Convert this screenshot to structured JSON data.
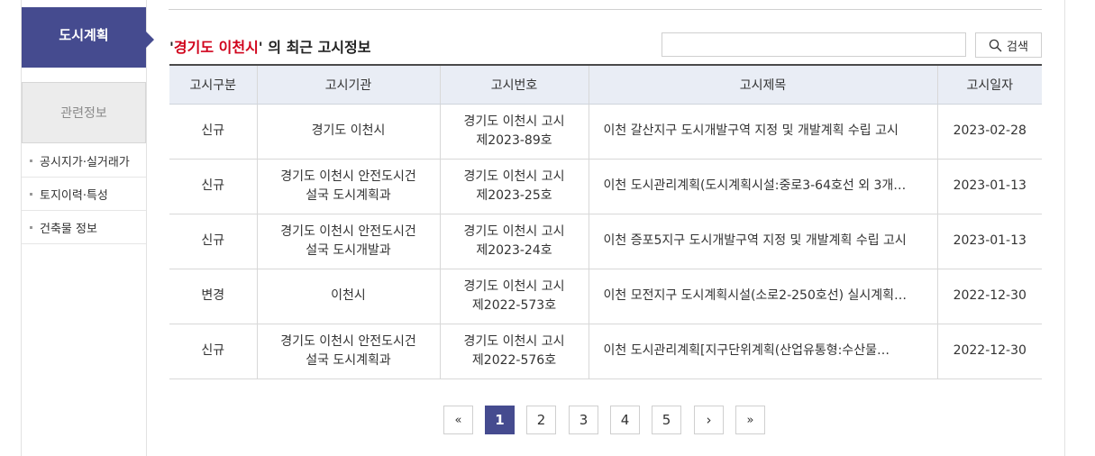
{
  "sidebar": {
    "active_menu": "도시계획",
    "related_header": "관련정보",
    "items": [
      "공시지가·실거래가",
      "토지이력·특성",
      "건축물 정보"
    ]
  },
  "title": {
    "quote_open": "'",
    "region": "경기도 이천시",
    "quote_close": "'",
    "suffix": " 의 최근 고시정보"
  },
  "search": {
    "placeholder": "",
    "button_label": "검색"
  },
  "table": {
    "headers": [
      "고시구분",
      "고시기관",
      "고시번호",
      "고시제목",
      "고시일자"
    ],
    "rows": [
      {
        "type": "신규",
        "agency": "경기도 이천시",
        "number_line1": "경기도 이천시 고시",
        "number_line2": "제2023-89호",
        "subject": "이천 갈산지구 도시개발구역 지정 및 개발계획 수립 고시",
        "date": "2023-02-28"
      },
      {
        "type": "신규",
        "agency": "경기도 이천시 안전도시건설국 도시계획과",
        "number_line1": "경기도 이천시 고시",
        "number_line2": "제2023-25호",
        "subject": "이천 도시관리계획(도시계획시설:중로3-64호선 외 3개…",
        "date": "2023-01-13"
      },
      {
        "type": "신규",
        "agency": "경기도 이천시 안전도시건설국 도시개발과",
        "number_line1": "경기도 이천시 고시",
        "number_line2": "제2023-24호",
        "subject": "이천 증포5지구 도시개발구역 지정 및 개발계획 수립 고시",
        "date": "2023-01-13"
      },
      {
        "type": "변경",
        "agency": "이천시",
        "number_line1": "경기도 이천시 고시",
        "number_line2": "제2022-573호",
        "subject": "이천 모전지구 도시계획시설(소로2-250호선) 실시계획…",
        "date": "2022-12-30"
      },
      {
        "type": "신규",
        "agency": "경기도 이천시 안전도시건설국 도시계획과",
        "number_line1": "경기도 이천시 고시",
        "number_line2": "제2022-576호",
        "subject": "이천 도시관리계획[지구단위계획(산업유통형:수산물…",
        "date": "2022-12-30"
      }
    ]
  },
  "pagination": {
    "first": "«",
    "prev": "›",
    "next": "›",
    "last": "»",
    "pages": [
      "1",
      "2",
      "3",
      "4",
      "5"
    ],
    "current": "1"
  },
  "colors": {
    "accent": "#454b8f",
    "highlight": "#d0021b",
    "header_bg": "#e9edf5"
  },
  "icons": {
    "search": "magnifier-icon"
  }
}
